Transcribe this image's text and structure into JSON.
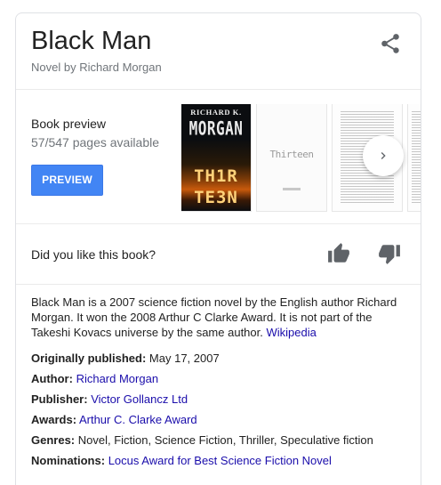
{
  "header": {
    "title": "Black Man",
    "subtitle": "Novel by Richard Morgan",
    "share_icon": "share-icon"
  },
  "preview": {
    "label": "Book preview",
    "pages": "57/547 pages available",
    "button_label": "PREVIEW",
    "button_color": "#4285f4",
    "cover": {
      "author": "RICHARD K.",
      "name": "MORGAN",
      "title_line1": "TH1R",
      "title_line2": "TE3N"
    },
    "title_page_text": "Thirteen",
    "next_icon": "chevron-right-icon"
  },
  "rating": {
    "question": "Did you like this book?",
    "like_icon": "thumb-up-icon",
    "dislike_icon": "thumb-down-icon"
  },
  "description": {
    "text": "Black Man is a 2007 science fiction novel by the English author Richard Morgan. It won the 2008 Arthur C Clarke Award. It is not part of the Takeshi Kovacs universe by the same author.",
    "source_link": "Wikipedia"
  },
  "facts": [
    {
      "label": "Originally published:",
      "value": "May 17, 2007",
      "is_link": false
    },
    {
      "label": "Author:",
      "value": "Richard Morgan",
      "is_link": true
    },
    {
      "label": "Publisher:",
      "value": "Victor Gollancz Ltd",
      "is_link": true
    },
    {
      "label": "Awards:",
      "value": "Arthur C. Clarke Award",
      "is_link": true
    },
    {
      "label": "Genres:",
      "value": "Novel, Fiction, Science Fiction, Thriller, Speculative fiction",
      "is_link": false
    },
    {
      "label": "Nominations:",
      "value": "Locus Award for Best Science Fiction Novel",
      "is_link": true
    }
  ],
  "colors": {
    "link": "#1a0dab",
    "secondary_text": "#70757a",
    "icon": "#5f6368"
  }
}
